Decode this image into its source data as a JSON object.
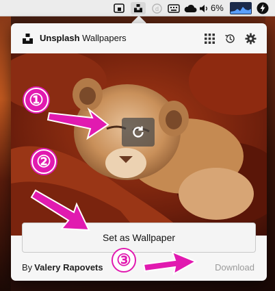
{
  "menubar": {
    "battery_percent": "6%",
    "icons": [
      "window-icon",
      "unsplash-wallpapers-icon",
      "d-icon",
      "keyboard-icon",
      "cloud-icon",
      "volume-icon",
      "battery-icon",
      "cpu-graph-icon",
      "bolt-icon"
    ]
  },
  "header": {
    "app_name_bold": "Unsplash",
    "app_name_rest": "Wallpapers",
    "icons": [
      "grid-icon",
      "history-icon",
      "settings-gear-icon"
    ]
  },
  "photo": {
    "refresh_icon": "refresh-icon"
  },
  "footer": {
    "set_wallpaper_label": "Set as Wallpaper",
    "credit_prefix": "By",
    "photographer": "Valery Rapovets",
    "download_label": "Download"
  },
  "annotations": {
    "step1": "①",
    "step2": "②",
    "step3": "③",
    "accent": "#e11ab0"
  },
  "colors": {
    "popover_bg": "#f6f6f6",
    "download_text": "#9a9a9a",
    "accent": "#e11ab0"
  }
}
